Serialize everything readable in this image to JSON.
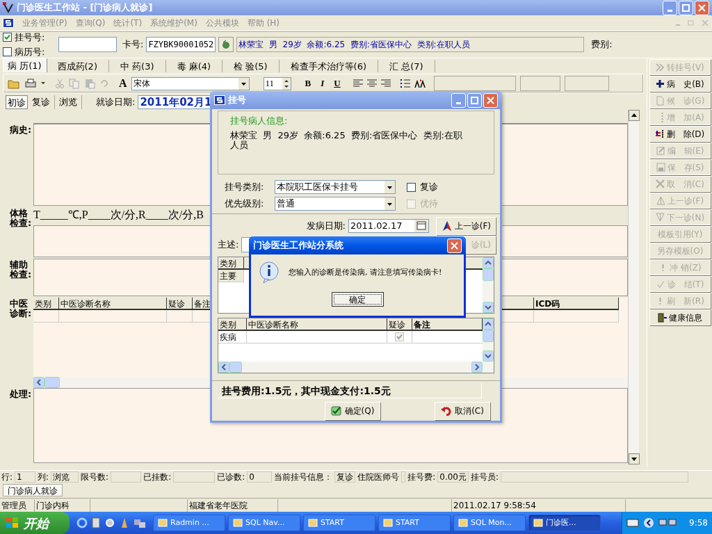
{
  "window": {
    "title": "门诊医生工作站 - [门诊病人就诊]"
  },
  "menu": [
    "业务管理(P)",
    "查询(Q)",
    "统计(T)",
    "系统维护(M)",
    "公共模块",
    "帮助 (H)"
  ],
  "patient_bar": {
    "checks": [
      {
        "label": "挂号号:",
        "checked": true
      },
      {
        "label": "病历号:",
        "checked": false
      }
    ],
    "card_label": "卡号:",
    "card_no": "FZYBK90001052",
    "info": "林荣宝  男  29岁  余额:6.25  费别:省医保中心  类别:在职人员",
    "fee_label": "费别:"
  },
  "tabs": [
    {
      "label": "病 历(1)",
      "selected": true
    },
    {
      "label": "西成药(2)",
      "selected": false
    },
    {
      "label": "中 药(3)",
      "selected": false
    },
    {
      "label": "毒 麻(4)",
      "selected": false
    },
    {
      "label": "检 验(5)",
      "selected": false
    },
    {
      "label": "检查手术治疗等(6)",
      "selected": false
    },
    {
      "label": "汇 总(7)",
      "selected": false
    }
  ],
  "toolbar": {
    "font_label": "A",
    "font": "宋体",
    "size": "11",
    "format_buttons": [
      "B",
      "I",
      "U"
    ]
  },
  "visit_tabs": [
    {
      "label": "初诊",
      "selected": true
    },
    {
      "label": "复诊",
      "selected": false
    },
    {
      "label": "浏览",
      "selected": false
    }
  ],
  "visit_date": {
    "label": "就诊日期:",
    "value": "2011年02月1"
  },
  "form": {
    "sections": [
      {
        "kind": "text",
        "label": "病史:"
      },
      {
        "kind": "exam",
        "label": "体格检查:",
        "template": "T_____℃,P____次/分,R____次/分,B"
      },
      {
        "kind": "text",
        "label": "辅助检查:"
      },
      {
        "kind": "grid",
        "label": "中医诊断:",
        "columns": [
          "类别",
          "中医诊断名称",
          "疑诊",
          "备注",
          "ICD码"
        ]
      },
      {
        "kind": "text",
        "label": "处理:"
      }
    ]
  },
  "side_buttons": [
    {
      "label": "转挂号(V)",
      "kind": "chevrons",
      "disabled": true
    },
    {
      "label": "病　史(B)",
      "kind": "plus",
      "disabled": false
    },
    {
      "label": "候　诊(G)",
      "kind": "page",
      "disabled": true
    },
    {
      "label": "增　加(A)",
      "kind": "dots",
      "disabled": true
    },
    {
      "label": "删　除(D)",
      "kind": "remove",
      "disabled": false
    },
    {
      "label": "编　辑(E)",
      "kind": "edit",
      "disabled": true
    },
    {
      "label": "保　存(S)",
      "kind": "save",
      "disabled": true
    },
    {
      "label": "取　消(C)",
      "kind": "cross",
      "disabled": true
    },
    {
      "label": "上一诊(F)",
      "kind": "up",
      "disabled": true
    },
    {
      "label": "下一诊(N)",
      "kind": "down",
      "disabled": true
    },
    {
      "label": "模板引用(Y)",
      "kind": "plain",
      "disabled": true
    },
    {
      "label": "另存模板(O)",
      "kind": "plain",
      "disabled": true
    },
    {
      "label": "冲 销(Z)",
      "kind": "exclaim",
      "disabled": true
    },
    {
      "label": "诊　结(T)",
      "kind": "tick",
      "disabled": true
    },
    {
      "label": "刷　新(R)",
      "kind": "exclaim",
      "disabled": true
    },
    {
      "label": "健康信息",
      "kind": "door",
      "disabled": false
    }
  ],
  "status_fields": [
    {
      "label": "行:",
      "value": "1"
    },
    {
      "label": "列:",
      "value": "浏览"
    },
    {
      "label": "限号数:"
    },
    {
      "label": "已挂数:"
    },
    {
      "label": "已诊数:",
      "value": "0"
    },
    {
      "label": "当前挂号信息：",
      "value": "复诊"
    },
    {
      "label": "住院医师号"
    },
    {
      "label": "挂号费:",
      "value": "0.00元"
    },
    {
      "label": "挂号员:"
    }
  ],
  "doc_tabs": [
    {
      "label": "门诊病人就诊",
      "selected": true
    }
  ],
  "status_bar": [
    "管理员",
    "门诊内科",
    "福建省老年医院",
    "2011.02.17 9:58:54"
  ],
  "taskbar": {
    "start": "开始",
    "tasks": [
      {
        "label": "Radmin ...",
        "selected": false
      },
      {
        "label": "SQL Nav...",
        "selected": false
      },
      {
        "label": "START",
        "selected": false
      },
      {
        "label": "START",
        "selected": false
      },
      {
        "label": "SQL Mon...",
        "selected": false
      },
      {
        "label": "门诊医...",
        "selected": true
      }
    ],
    "clock": "9:58"
  },
  "register_dialog": {
    "title": "挂号",
    "info_title": "挂号病人信息:",
    "info": "林荣宝  男  29岁  余额:6.25  费别:省医保中心  类别:在职人员",
    "fields": [
      {
        "label": "挂号类别:",
        "value": "本院职工医保卡挂号",
        "option": {
          "label": "复诊",
          "checked": false,
          "disabled": false
        }
      },
      {
        "label": "优先级别:",
        "value": "普通",
        "option": {
          "label": "优待",
          "checked": false,
          "disabled": true
        }
      }
    ],
    "onset": {
      "label": "发病日期:",
      "value": "2011.02.17"
    },
    "nav_buttons": [
      {
        "label": "上一诊(F)",
        "disabled": false
      },
      {
        "label": "诊(L)",
        "disabled": true
      }
    ],
    "complaint_label": "主述:",
    "western_grid": {
      "columns": [
        "类别"
      ],
      "rows": [
        "主要"
      ]
    },
    "tcm_grid": {
      "columns": [
        "类别",
        "中医诊断名称",
        "疑诊",
        "备注"
      ],
      "rows": [
        {
          "category": "疾病",
          "suspected": true
        }
      ]
    },
    "fee": "挂号费用:1.5元，其中现金支付:1.5元",
    "buttons": [
      {
        "label": "确定(Q)",
        "kind": "ok"
      },
      {
        "label": "取消(C)",
        "kind": "cancel"
      }
    ]
  },
  "message_box": {
    "title": "门诊医生工作站分系统",
    "message": "您输入的诊断是传染病, 请注意填写传染病卡!",
    "button": "确定"
  }
}
